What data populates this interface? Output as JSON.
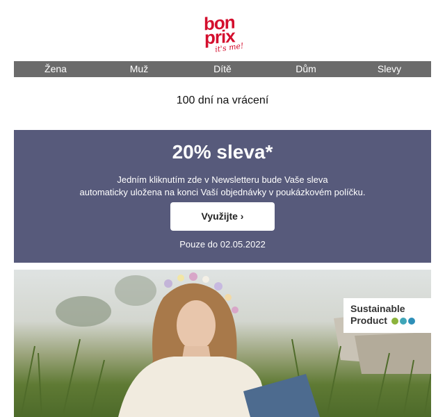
{
  "brand": {
    "line1": "bon",
    "line2": "prix",
    "tagline": "it's me!",
    "color": "#d40f2e"
  },
  "nav": {
    "items": [
      {
        "label": "Žena"
      },
      {
        "label": "Muž"
      },
      {
        "label": "Dítě"
      },
      {
        "label": "Dům"
      },
      {
        "label": "Slevy"
      }
    ],
    "background": "#6b6b6b"
  },
  "returns_text": "100 dní na vrácení",
  "promo": {
    "headline": "20% sleva*",
    "line1": "Jedním kliknutím zde v Newsletteru bude Vaše sleva",
    "line2": "automaticky uložena na konci Vaší objednávky v poukázkovém políčku.",
    "cta_label": "Využijte ›",
    "validity": "Pouze do 02.05.2022",
    "background": "#575a7b"
  },
  "hero": {
    "badge_line1": "Sustainable",
    "badge_line2": "Product",
    "badge_dot_colors": [
      "#8cb33c",
      "#3fa6b8",
      "#2e8fb8"
    ]
  }
}
